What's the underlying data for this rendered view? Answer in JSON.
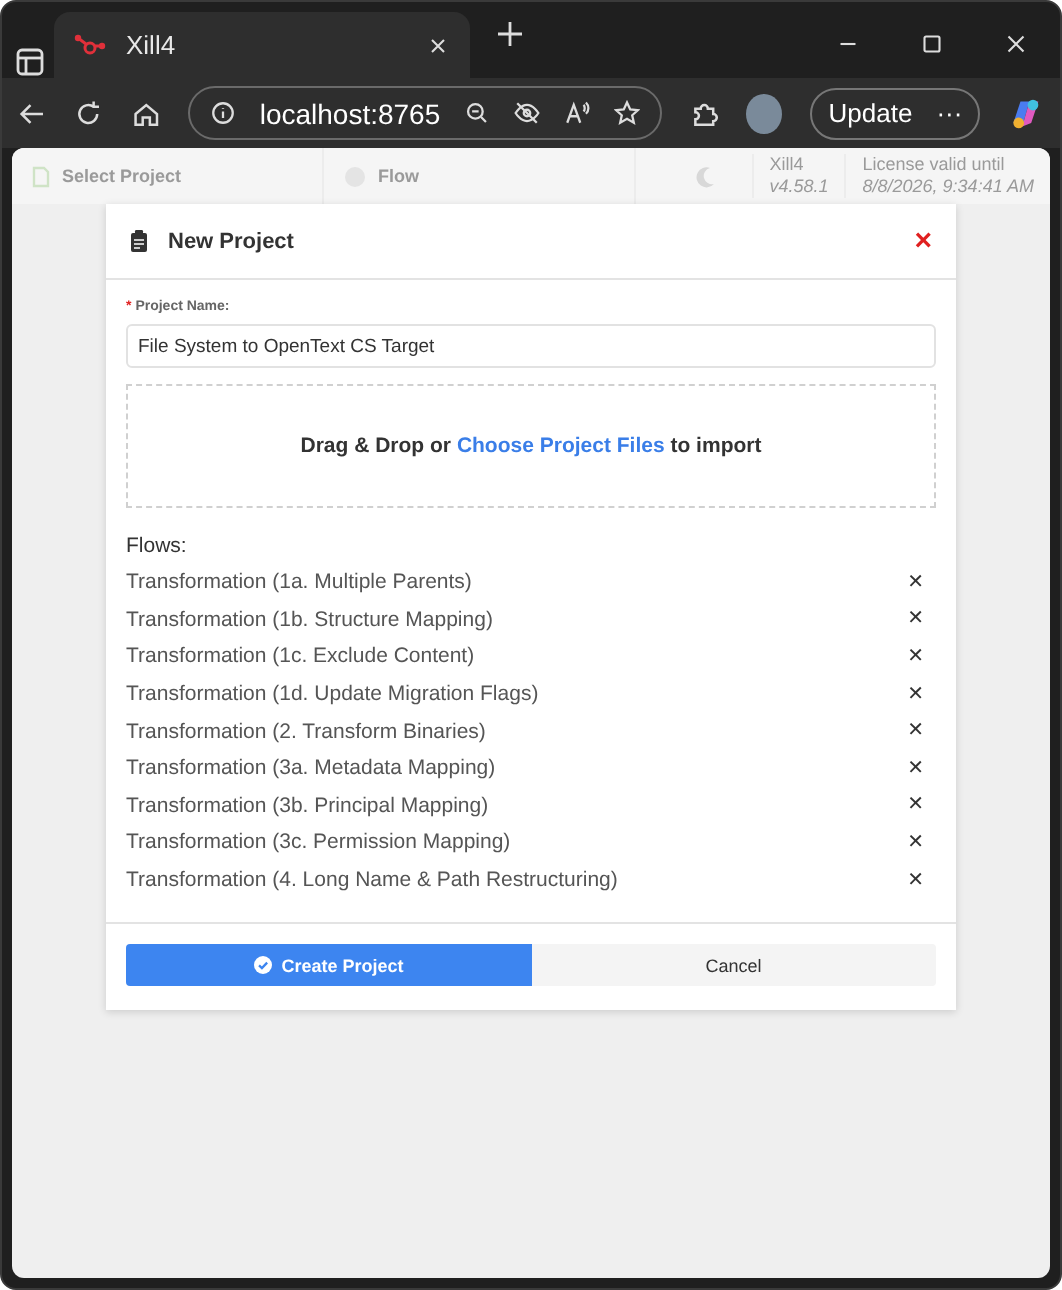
{
  "browser": {
    "tab_title": "Xill4",
    "address": "localhost:8765",
    "update_label": "Update",
    "more_label": "···"
  },
  "app_toolbar": {
    "select_project": "Select Project",
    "flow": "Flow",
    "app_name": "Xill4",
    "version": "v4.58.1",
    "license_label": "License valid until",
    "license_date": "8/8/2026, 9:34:41 AM"
  },
  "dialog": {
    "title": "New Project",
    "close": "×",
    "name_field": {
      "required_mark": "*",
      "label": "Project Name:",
      "value": "File System to OpenText CS Target"
    },
    "dropzone": {
      "before": "Drag & Drop or",
      "link": "Choose Project Files",
      "after": "to import"
    },
    "flows_label": "Flows:",
    "flows": [
      {
        "name": "Transformation (1a. Multiple Parents)",
        "remove": "✕"
      },
      {
        "name": "Transformation (1b. Structure Mapping)",
        "remove": "✕"
      },
      {
        "name": "Transformation (1c. Exclude Content)",
        "remove": "✕"
      },
      {
        "name": "Transformation (1d. Update Migration Flags)",
        "remove": "✕"
      },
      {
        "name": "Transformation (2. Transform Binaries)",
        "remove": "✕"
      },
      {
        "name": "Transformation (3a. Metadata Mapping)",
        "remove": "✕"
      },
      {
        "name": "Transformation (3b. Principal Mapping)",
        "remove": "✕"
      },
      {
        "name": "Transformation (3c. Permission Mapping)",
        "remove": "✕"
      },
      {
        "name": "Transformation (4. Long Name & Path Restructuring)",
        "remove": "✕"
      }
    ],
    "buttons": [
      {
        "label": "Create Project",
        "kind": "primary"
      },
      {
        "label": "Cancel",
        "kind": "secondary"
      }
    ]
  }
}
